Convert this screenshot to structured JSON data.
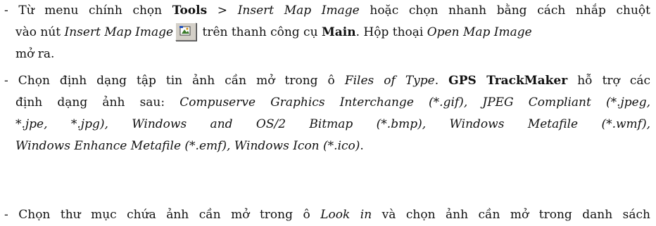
{
  "para1": {
    "t1": "- Từ menu chính chọn ",
    "b1": "Tools",
    "t2": " > ",
    "i1": "Insert Map Image",
    "t3": " hoặc chọn nhanh bằng cách nhắp chuột",
    "t4": "vào nút ",
    "i2": "Insert Map Image",
    "t5": " trên thanh công cụ ",
    "b2": "Main",
    "t6": ". Hộp thoại ",
    "i3": "Open Map Image",
    "t7": "mở ra.",
    "icon": "insert-map-image-icon"
  },
  "para2": {
    "t1": "- Chọn định dạng tập tin ảnh cần mở trong ô ",
    "i1": "Files of Type",
    "t2": ". ",
    "b1": "GPS TrackMaker",
    "t3": " hỗ trợ các",
    "t4": "định dạng ảnh sau: ",
    "i2": "Compuserve Graphics Interchange (*.gif), JPEG Compliant (*.jpeg,",
    "i3": "*.jpe, *.jpg), Windows and OS/2 Bitmap (*.bmp), Windows Metafile (*.wmf),",
    "i4": "Windows Enhance Metafile (*.emf), Windows Icon (*.ico)",
    "t5": "."
  },
  "para3": {
    "t1": "- Chọn thư mục chứa ảnh cần mở trong ô ",
    "i1": "Look in",
    "t2": " và chọn ảnh cần mở trong danh sách"
  }
}
